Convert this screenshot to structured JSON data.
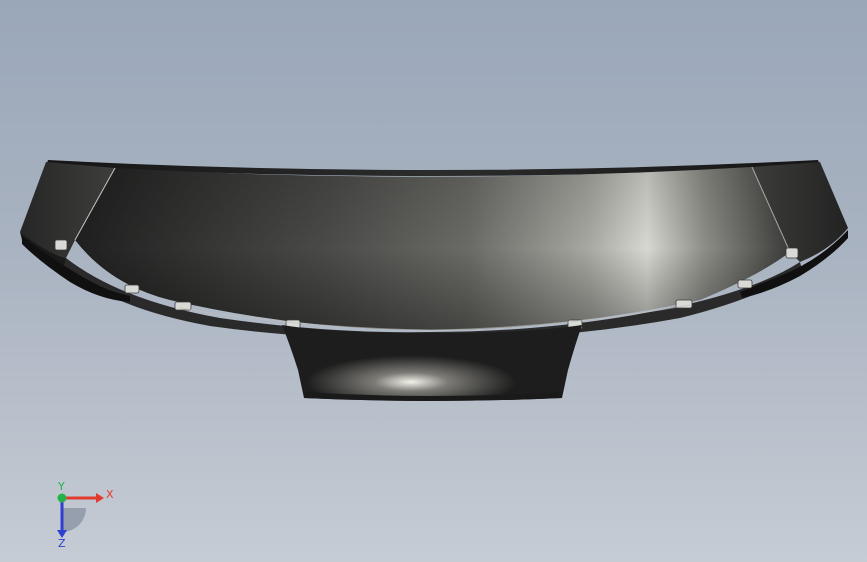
{
  "viewport": {
    "background_top": "#9aa7b9",
    "background_bottom": "#c6ccd4"
  },
  "model": {
    "part_color": "#2a2a2a",
    "highlight_color": "#e6e6e0"
  },
  "triad": {
    "x_label": "X",
    "y_label": "Y",
    "z_label": "Z",
    "x_color": "#e23b2e",
    "y_color": "#23b34a",
    "z_color": "#2f3fd0"
  }
}
